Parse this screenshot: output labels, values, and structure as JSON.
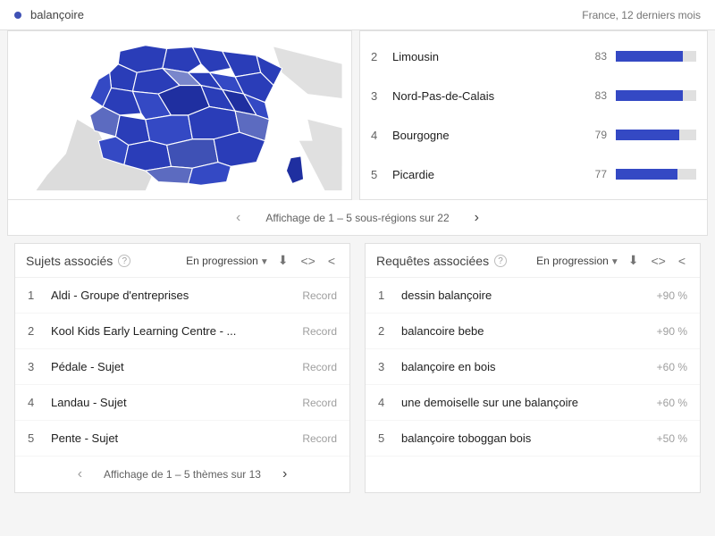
{
  "topbar": {
    "term": "balançoire",
    "scope": "France, 12 derniers mois"
  },
  "regions": {
    "items": [
      {
        "rank": "2",
        "name": "Limousin",
        "value": "83",
        "pct": 83
      },
      {
        "rank": "3",
        "name": "Nord-Pas-de-Calais",
        "value": "83",
        "pct": 83
      },
      {
        "rank": "4",
        "name": "Bourgogne",
        "value": "79",
        "pct": 79
      },
      {
        "rank": "5",
        "name": "Picardie",
        "value": "77",
        "pct": 77
      }
    ],
    "pager": "Affichage de 1 – 5 sous-régions sur 22"
  },
  "topics": {
    "title": "Sujets associés",
    "filter": "En progression",
    "items": [
      {
        "rank": "1",
        "label": "Aldi - Groupe d'entreprises",
        "metric": "Record"
      },
      {
        "rank": "2",
        "label": "Kool Kids Early Learning Centre - ...",
        "metric": "Record"
      },
      {
        "rank": "3",
        "label": "Pédale - Sujet",
        "metric": "Record"
      },
      {
        "rank": "4",
        "label": "Landau - Sujet",
        "metric": "Record"
      },
      {
        "rank": "5",
        "label": "Pente - Sujet",
        "metric": "Record"
      }
    ],
    "pager": "Affichage de 1 – 5 thèmes sur 13"
  },
  "queries": {
    "title": "Requêtes associées",
    "filter": "En progression",
    "items": [
      {
        "rank": "1",
        "label": "dessin balançoire",
        "metric": "+90 %"
      },
      {
        "rank": "2",
        "label": "balancoire bebe",
        "metric": "+90 %"
      },
      {
        "rank": "3",
        "label": "balançoire en bois",
        "metric": "+60 %"
      },
      {
        "rank": "4",
        "label": "une demoiselle sur une balançoire",
        "metric": "+60 %"
      },
      {
        "rank": "5",
        "label": "balançoire toboggan bois",
        "metric": "+50 %"
      }
    ],
    "pager": ""
  }
}
